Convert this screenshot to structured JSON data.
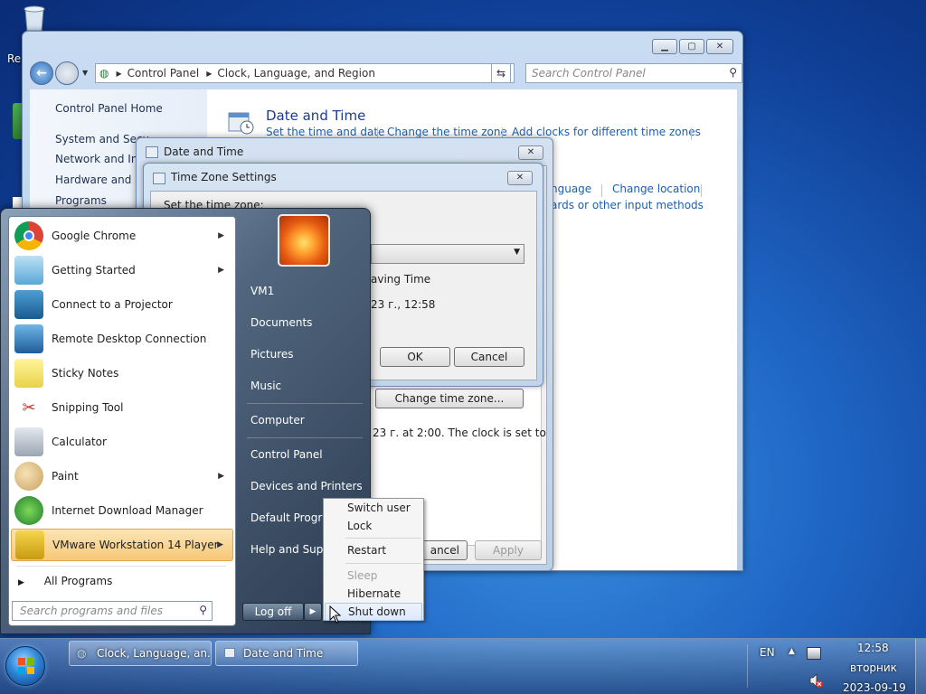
{
  "desktop": {
    "recycle_label": "Re"
  },
  "control_panel": {
    "breadcrumb": [
      "Control Panel",
      "Clock, Language, and Region"
    ],
    "search_placeholder": "Search Control Panel",
    "sidebar": [
      "Control Panel Home",
      "System and Secu",
      "Network and Inte",
      "Hardware and So",
      "Programs"
    ],
    "section_title": "Date and Time",
    "links_row1": [
      "Set the time and date",
      "Change the time zone",
      "Add clocks for different time zones"
    ],
    "links_row2": [
      "nguage",
      "Change location"
    ],
    "links_row3": "ards or other input methods"
  },
  "date_time_dialog": {
    "title": "Date and Time",
    "change_tz_button": "Change time zone...",
    "dst_text": "23 г. at 2:00. The clock is set to",
    "cancel": "ancel",
    "apply": "Apply"
  },
  "tz_dialog": {
    "title": "Time Zone Settings",
    "set_label": "Set the time zone:",
    "dst_partial": "aving Time",
    "time_partial": "23 г., 12:58",
    "ok": "OK",
    "cancel": "Cancel"
  },
  "start_menu": {
    "programs": [
      {
        "label": "Google Chrome",
        "icon": "chrome-icon",
        "arrow": true
      },
      {
        "label": "Getting Started",
        "icon": "getting-started-icon",
        "arrow": true
      },
      {
        "label": "Connect to a Projector",
        "icon": "projector-icon",
        "arrow": false
      },
      {
        "label": "Remote Desktop Connection",
        "icon": "remote-desktop-icon",
        "arrow": false
      },
      {
        "label": "Sticky Notes",
        "icon": "sticky-notes-icon",
        "arrow": false
      },
      {
        "label": "Snipping Tool",
        "icon": "snipping-tool-icon",
        "arrow": false
      },
      {
        "label": "Calculator",
        "icon": "calculator-icon",
        "arrow": false
      },
      {
        "label": "Paint",
        "icon": "paint-icon",
        "arrow": true
      },
      {
        "label": "Internet Download Manager",
        "icon": "idm-icon",
        "arrow": false
      },
      {
        "label": "VMware Workstation 14 Player",
        "icon": "vmware-icon",
        "arrow": true
      }
    ],
    "all_programs": "All Programs",
    "search_placeholder": "Search programs and files",
    "right_items": [
      "VM1",
      "Documents",
      "Pictures",
      "Music",
      "Computer",
      "Control Panel",
      "Devices and Printers",
      "Default Programs",
      "Help and Support"
    ],
    "logoff": "Log off"
  },
  "shutdown_menu": {
    "items": [
      "Switch user",
      "Lock",
      "Restart",
      "Sleep",
      "Hibernate",
      "Shut down"
    ],
    "disabled": [
      "Sleep"
    ],
    "highlighted": "Shut down"
  },
  "taskbar": {
    "buttons": [
      "Clock, Language, an...",
      "Date and Time"
    ],
    "language": "EN",
    "time": "12:58",
    "day": "вторник",
    "date": "2023-09-19"
  },
  "colors": {
    "link": "#1a5fb4",
    "accent_highlight": "#f6c877"
  }
}
